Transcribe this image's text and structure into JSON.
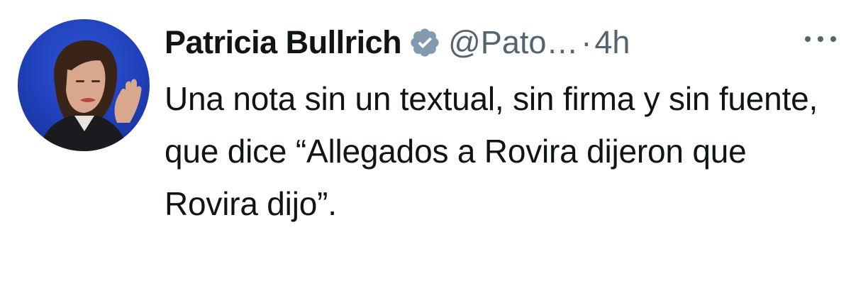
{
  "tweet": {
    "author_name": "Patricia Bullrich",
    "handle": "@Pato…",
    "separator": "·",
    "time": "4h",
    "text": "Una nota sin un textual, sin firma y sin fuente, que dice “Allegados a Rovira dijeron que Rovira dijo”.",
    "verified_icon": "verified-badge-icon",
    "more_icon": "more-options-icon",
    "colors": {
      "verified": "#829aab",
      "secondary_text": "#536471",
      "primary_text": "#0f1419",
      "avatar_background": "#1f3fb8"
    }
  }
}
